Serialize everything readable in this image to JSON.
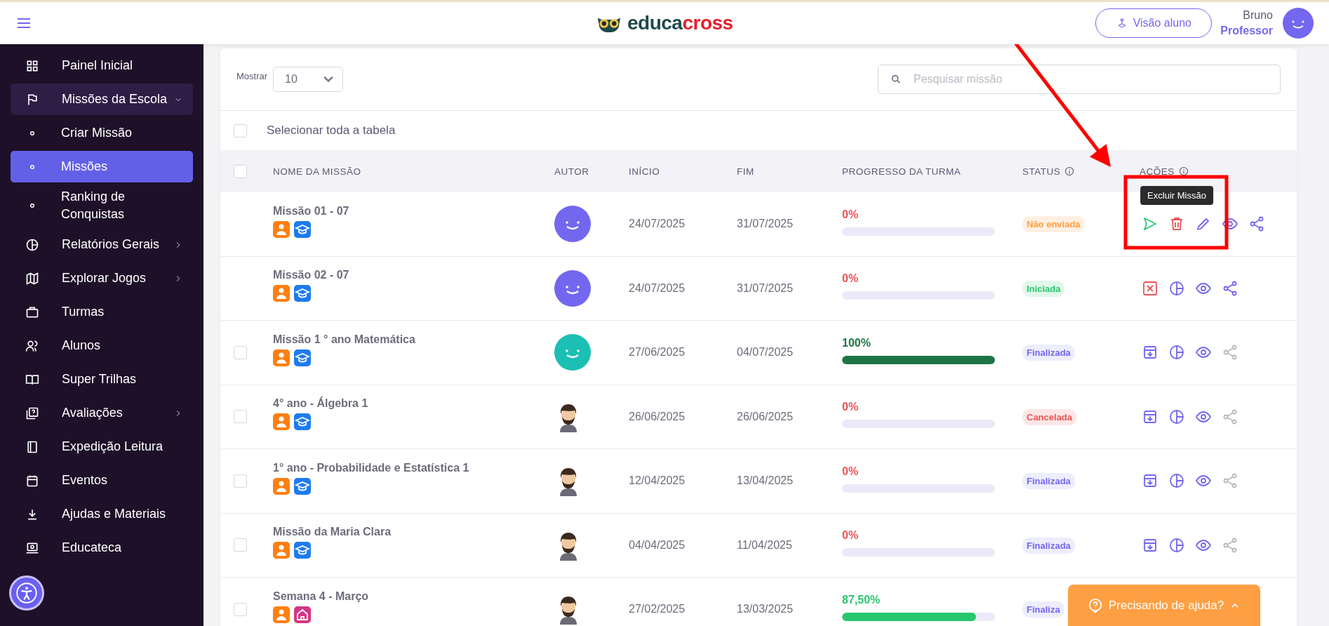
{
  "header": {
    "logo": {
      "first": "educa",
      "second": "cross"
    },
    "student_view_button": "Visão aluno",
    "user": {
      "name": "Bruno",
      "role": "Professor"
    }
  },
  "sidebar": {
    "items": [
      {
        "label": "Painel Inicial",
        "kind": "grid",
        "selected": false
      },
      {
        "label": "Missões da Escola",
        "kind": "flag",
        "selected": false,
        "expanded": true,
        "children": [
          {
            "label": "Criar Missão",
            "kind": "dot",
            "selected": false
          },
          {
            "label": "Missões",
            "kind": "dot",
            "selected": true
          },
          {
            "label": "Ranking de Conquistas",
            "kind": "dot",
            "selected": false
          }
        ]
      },
      {
        "label": "Relatórios Gerais",
        "kind": "pie",
        "selected": false,
        "expanded": false
      },
      {
        "label": "Explorar Jogos",
        "kind": "map",
        "selected": false,
        "expanded": false
      },
      {
        "label": "Turmas",
        "kind": "briefcase",
        "selected": false
      },
      {
        "label": "Alunos",
        "kind": "users",
        "selected": false
      },
      {
        "label": "Super Trilhas",
        "kind": "book",
        "selected": false
      },
      {
        "label": "Avaliações",
        "kind": "quiz",
        "selected": false,
        "expanded": false
      },
      {
        "label": "Expedição Leitura",
        "kind": "bookmark",
        "selected": false
      },
      {
        "label": "Eventos",
        "kind": "calendar",
        "selected": false
      },
      {
        "label": "Ajudas e Materiais",
        "kind": "download",
        "selected": false
      },
      {
        "label": "Educateca",
        "kind": "laptop",
        "selected": false
      }
    ]
  },
  "toolbar": {
    "show_label": "Mostrar",
    "page_size": "10",
    "search": {
      "placeholder": "Pesquisar missão"
    }
  },
  "select_all": {
    "label": "Selecionar toda a tabela",
    "checked": false
  },
  "table": {
    "header_checked": false,
    "columns": [
      {
        "label": "NOME DA MISSÃO",
        "info": false
      },
      {
        "label": "AUTOR",
        "info": false
      },
      {
        "label": "INÍCIO",
        "info": false
      },
      {
        "label": "FIM",
        "info": false
      },
      {
        "label": "PROGRESSO DA TURMA",
        "info": false
      },
      {
        "label": "STATUS",
        "info": true
      },
      {
        "label": "AÇÕES",
        "info": true
      }
    ],
    "rows": [
      {
        "name": "Missão 01 - 07",
        "tags": [
          {
            "kind": "person"
          },
          {
            "kind": "school"
          }
        ],
        "author": {
          "kind": "smiley",
          "color": "#7367f0"
        },
        "start": "24/07/2025",
        "end": "31/07/2025",
        "progress": {
          "text": "0%",
          "level": 0,
          "color": "#ea5455"
        },
        "status": {
          "label": "Não enviada",
          "kind": "not_sent"
        },
        "actions": [
          {
            "kind": "send",
            "disabled": false
          },
          {
            "kind": "delete",
            "disabled": false,
            "tooltip": "Excluir Missão"
          },
          {
            "kind": "edit",
            "disabled": false
          },
          {
            "kind": "view",
            "disabled": false
          },
          {
            "kind": "share",
            "disabled": false
          }
        ]
      },
      {
        "name": "Missão 02 - 07",
        "tags": [
          {
            "kind": "person"
          },
          {
            "kind": "school"
          }
        ],
        "author": {
          "kind": "smiley",
          "color": "#7367f0"
        },
        "start": "24/07/2025",
        "end": "31/07/2025",
        "progress": {
          "text": "0%",
          "level": 0,
          "color": "#ea5455"
        },
        "status": {
          "label": "Iniciada",
          "kind": "started"
        },
        "actions": [
          {
            "kind": "cancel",
            "disabled": false
          },
          {
            "kind": "report",
            "disabled": false
          },
          {
            "kind": "view",
            "disabled": false
          },
          {
            "kind": "share",
            "disabled": false
          }
        ]
      },
      {
        "name": "Missão 1 ° ano Matemática",
        "checked": false,
        "tags": [
          {
            "kind": "person"
          },
          {
            "kind": "school"
          }
        ],
        "author": {
          "kind": "smiley",
          "color": "#1cbfb4"
        },
        "start": "27/06/2025",
        "end": "04/07/2025",
        "progress": {
          "text": "100%",
          "level": 1,
          "color": "#1e7544"
        },
        "status": {
          "label": "Finalizada",
          "kind": "finished"
        },
        "actions": [
          {
            "kind": "archive",
            "disabled": false
          },
          {
            "kind": "report",
            "disabled": false
          },
          {
            "kind": "view",
            "disabled": false
          },
          {
            "kind": "share",
            "disabled": true
          }
        ]
      },
      {
        "name": "4° ano - Álgebra 1",
        "checked": false,
        "tags": [
          {
            "kind": "person"
          },
          {
            "kind": "school"
          }
        ],
        "author": {
          "kind": "figure"
        },
        "start": "26/06/2025",
        "end": "26/06/2025",
        "progress": {
          "text": "0%",
          "level": 0,
          "color": "#ea5455"
        },
        "status": {
          "label": "Cancelada",
          "kind": "cancelled"
        },
        "actions": [
          {
            "kind": "archive",
            "disabled": false
          },
          {
            "kind": "report",
            "disabled": false
          },
          {
            "kind": "view",
            "disabled": false
          },
          {
            "kind": "share",
            "disabled": true
          }
        ]
      },
      {
        "name": "1° ano - Probabilidade e Estatística 1",
        "checked": false,
        "tags": [
          {
            "kind": "person"
          },
          {
            "kind": "school"
          }
        ],
        "author": {
          "kind": "figure"
        },
        "start": "12/04/2025",
        "end": "13/04/2025",
        "progress": {
          "text": "0%",
          "level": 0,
          "color": "#ea5455"
        },
        "status": {
          "label": "Finalizada",
          "kind": "finished"
        },
        "actions": [
          {
            "kind": "archive",
            "disabled": false
          },
          {
            "kind": "report",
            "disabled": false
          },
          {
            "kind": "view",
            "disabled": false
          },
          {
            "kind": "share",
            "disabled": true
          }
        ]
      },
      {
        "name": "Missão da Maria Clara",
        "checked": false,
        "tags": [
          {
            "kind": "person"
          },
          {
            "kind": "school"
          }
        ],
        "author": {
          "kind": "figure"
        },
        "start": "04/04/2025",
        "end": "11/04/2025",
        "progress": {
          "text": "0%",
          "level": 0,
          "color": "#ea5455"
        },
        "status": {
          "label": "Finalizada",
          "kind": "finished"
        },
        "actions": [
          {
            "kind": "archive",
            "disabled": false
          },
          {
            "kind": "report",
            "disabled": false
          },
          {
            "kind": "view",
            "disabled": false
          },
          {
            "kind": "share",
            "disabled": true
          }
        ]
      },
      {
        "name": "Semana 4 - Março",
        "checked": false,
        "tags": [
          {
            "kind": "person"
          },
          {
            "kind": "home"
          }
        ],
        "author": {
          "kind": "figure"
        },
        "start": "27/02/2025",
        "end": "13/03/2025",
        "progress": {
          "text": "87,50%",
          "level": 0.875,
          "color": "#28c76f"
        },
        "status": {
          "label": "Finaliza",
          "kind": "finished"
        }
      }
    ]
  },
  "help_button": "Precisando de ajuda?"
}
